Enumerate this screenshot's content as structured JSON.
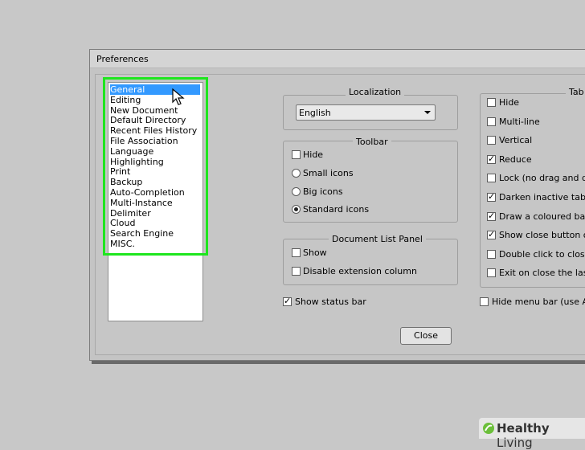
{
  "window": {
    "title": "Preferences"
  },
  "categories": [
    "General",
    "Editing",
    "New Document",
    "Default Directory",
    "Recent Files History",
    "File Association",
    "Language",
    "Highlighting",
    "Print",
    "Backup",
    "Auto-Completion",
    "Multi-Instance",
    "Delimiter",
    "Cloud",
    "Search Engine",
    "MISC."
  ],
  "selected_category": "General",
  "localization": {
    "label": "Localization",
    "value": "English"
  },
  "toolbar": {
    "label": "Toolbar",
    "hide": "Hide",
    "small": "Small icons",
    "big": "Big icons",
    "standard": "Standard icons",
    "selected": "Standard icons"
  },
  "doclist": {
    "label": "Document List Panel",
    "show": "Show",
    "disable_ext": "Disable extension column"
  },
  "status_bar": "Show status bar",
  "tab": {
    "label": "Tab",
    "items": [
      {
        "label": "Hide",
        "checked": false
      },
      {
        "label": "Multi-line",
        "checked": false
      },
      {
        "label": "Vertical",
        "checked": false
      },
      {
        "label": "Reduce",
        "checked": true
      },
      {
        "label": "Lock (no drag and drop",
        "checked": false
      },
      {
        "label": "Darken inactive tabs",
        "checked": true
      },
      {
        "label": "Draw a coloured bar on",
        "checked": true
      },
      {
        "label": "Show close button on e",
        "checked": true
      },
      {
        "label": "Double click to close do",
        "checked": false
      },
      {
        "label": "Exit on close the last ta",
        "checked": false
      }
    ]
  },
  "menu_bar": "Hide menu bar (use Alt o",
  "close_label": "Close",
  "watermark": {
    "text1": "Healthy",
    "text2": " Living"
  },
  "colors": {
    "highlight": "#1ee61e",
    "selection": "#3399ff"
  }
}
